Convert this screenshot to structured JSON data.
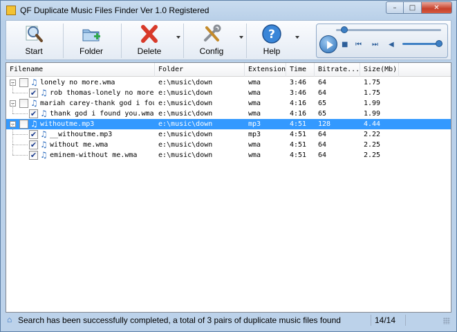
{
  "window": {
    "title": "QF Duplicate Music Files Finder  Ver 1.0  Registered",
    "minimize_glyph": "–",
    "maximize_glyph": "□",
    "close_glyph": "✕"
  },
  "toolbar": {
    "buttons": [
      {
        "label": "Start",
        "icon": "magnifier-icon"
      },
      {
        "label": "Folder",
        "icon": "folder-add-icon"
      },
      {
        "label": "Delete",
        "icon": "delete-x-icon"
      },
      {
        "label": "Config",
        "icon": "tools-icon"
      },
      {
        "label": "Help",
        "icon": "help-icon"
      }
    ]
  },
  "player": {
    "seek_position": 0.08,
    "volume": 1.0,
    "play_icon": "play-icon",
    "stop_glyph": "■",
    "prev_glyph": "⏮",
    "next_glyph": "⏭",
    "volume_glyph": "◀"
  },
  "list": {
    "columns": [
      "Filename",
      "Folder",
      "Extension",
      "Time",
      "Bitrate...",
      "Size(Mb)"
    ],
    "rows": [
      {
        "level": 0,
        "checked": false,
        "filename": "lonely no more.wma",
        "folder": "e:\\music\\down",
        "extension": "wma",
        "time": "3:46",
        "bitrate": "64",
        "size": "1.75",
        "selected": false
      },
      {
        "level": 1,
        "checked": true,
        "filename": "rob thomas-lonely no more...",
        "folder": "e:\\music\\down",
        "extension": "wma",
        "time": "3:46",
        "bitrate": "64",
        "size": "1.75",
        "selected": false
      },
      {
        "level": 0,
        "checked": false,
        "filename": "mariah carey-thank god i fou...",
        "folder": "e:\\music\\down",
        "extension": "wma",
        "time": "4:16",
        "bitrate": "65",
        "size": "1.99",
        "selected": false
      },
      {
        "level": 1,
        "checked": true,
        "filename": "thank god i found you.wma",
        "folder": "e:\\music\\down",
        "extension": "wma",
        "time": "4:16",
        "bitrate": "65",
        "size": "1.99",
        "selected": false
      },
      {
        "level": 0,
        "checked": false,
        "filename": "withoutme.mp3",
        "folder": "e:\\music\\down",
        "extension": "mp3",
        "time": "4:51",
        "bitrate": "128",
        "size": "4.44",
        "selected": true
      },
      {
        "level": 1,
        "checked": true,
        "filename": "__withoutme.mp3",
        "folder": "e:\\music\\down",
        "extension": "mp3",
        "time": "4:51",
        "bitrate": "64",
        "size": "2.22",
        "selected": false
      },
      {
        "level": 1,
        "checked": true,
        "filename": "without me.wma",
        "folder": "e:\\music\\down",
        "extension": "wma",
        "time": "4:51",
        "bitrate": "64",
        "size": "2.25",
        "selected": false
      },
      {
        "level": 1,
        "checked": true,
        "filename": "eminem-without me.wma",
        "folder": "e:\\music\\down",
        "extension": "wma",
        "time": "4:51",
        "bitrate": "64",
        "size": "2.25",
        "selected": false
      }
    ]
  },
  "status": {
    "message": "Search has been successfully completed, a total of 3 pairs of duplicate music files found",
    "count": "14/14"
  },
  "colors": {
    "selection": "#3399ff",
    "accent": "#2b6cc0",
    "delete_red": "#d83a2a"
  }
}
